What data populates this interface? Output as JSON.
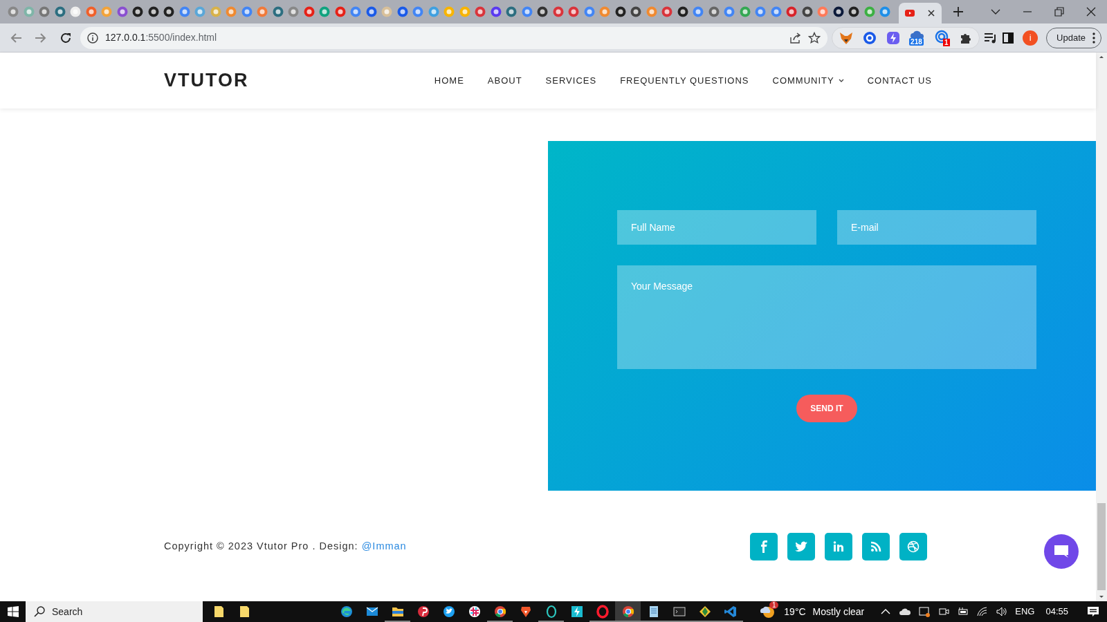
{
  "browser": {
    "tabs": [
      {
        "selected": false
      },
      {
        "selected": false
      },
      {
        "selected": false
      },
      {
        "selected": false
      },
      {
        "selected": false
      },
      {
        "selected": false
      },
      {
        "selected": false
      },
      {
        "selected": false
      },
      {
        "selected": false
      },
      {
        "selected": false
      },
      {
        "selected": false
      },
      {
        "selected": false
      },
      {
        "selected": false
      },
      {
        "selected": false
      },
      {
        "selected": false
      },
      {
        "selected": false
      },
      {
        "selected": false
      },
      {
        "selected": false
      },
      {
        "selected": false
      },
      {
        "selected": false
      },
      {
        "selected": false
      },
      {
        "selected": false
      },
      {
        "selected": false
      },
      {
        "selected": false
      },
      {
        "selected": false
      },
      {
        "selected": false
      },
      {
        "selected": false
      },
      {
        "selected": false
      },
      {
        "selected": false
      },
      {
        "selected": false
      },
      {
        "selected": false
      },
      {
        "selected": false
      },
      {
        "selected": false
      },
      {
        "selected": false
      },
      {
        "selected": false
      },
      {
        "selected": false
      },
      {
        "selected": false
      },
      {
        "selected": false
      },
      {
        "selected": false
      },
      {
        "selected": false
      },
      {
        "selected": false
      },
      {
        "selected": false
      },
      {
        "selected": false
      },
      {
        "selected": false
      },
      {
        "selected": false
      },
      {
        "selected": false
      },
      {
        "selected": false
      },
      {
        "selected": false
      },
      {
        "selected": false
      },
      {
        "selected": false
      },
      {
        "selected": false
      },
      {
        "selected": false
      },
      {
        "selected": false
      },
      {
        "selected": false
      },
      {
        "selected": false
      },
      {
        "selected": false
      },
      {
        "selected": false
      },
      {
        "selected": true
      }
    ],
    "address": {
      "host": "127.0.0.1",
      "rest": ":5500/index.html"
    },
    "extension_counter": "218",
    "extension_alert": "1",
    "profile_initial": "i",
    "update_button": "Update"
  },
  "site": {
    "logo": "VTUTOR",
    "nav": [
      {
        "label": "HOME",
        "dropdown": false
      },
      {
        "label": "ABOUT",
        "dropdown": false
      },
      {
        "label": "SERVICES",
        "dropdown": false
      },
      {
        "label": "FREQUENTLY QUESTIONS",
        "dropdown": false
      },
      {
        "label": "COMMUNITY",
        "dropdown": true
      },
      {
        "label": "CONTACT US",
        "dropdown": false
      }
    ],
    "form": {
      "name_placeholder": "Full Name",
      "email_placeholder": "E-mail",
      "message_placeholder": "Your Message",
      "submit": "SEND IT"
    },
    "footer": {
      "copyright": "Copyright © 2023 Vtutor Pro . Design: ",
      "credit_link": "@Imman"
    },
    "socials": [
      {
        "kind": "facebook"
      },
      {
        "kind": "twitter"
      },
      {
        "kind": "linkedin"
      },
      {
        "kind": "rss"
      },
      {
        "kind": "dribbble"
      }
    ]
  },
  "taskbar": {
    "search_placeholder": "Search",
    "apps": [
      {
        "kind": "note",
        "running": false,
        "active": false
      },
      {
        "kind": "note",
        "running": false,
        "active": false
      },
      {
        "kind": "edge",
        "running": false,
        "active": false
      },
      {
        "kind": "mail",
        "running": false,
        "active": false
      },
      {
        "kind": "folder",
        "running": true,
        "active": false
      },
      {
        "kind": "pinterest",
        "running": false,
        "active": false
      },
      {
        "kind": "twitter",
        "running": false,
        "active": false
      },
      {
        "kind": "slack",
        "running": false,
        "active": false
      },
      {
        "kind": "chrome",
        "running": true,
        "active": false
      },
      {
        "kind": "brave",
        "running": false,
        "active": false
      },
      {
        "kind": "ring",
        "running": true,
        "active": false
      },
      {
        "kind": "bolt",
        "running": false,
        "active": false
      },
      {
        "kind": "opera",
        "running": true,
        "active": false
      },
      {
        "kind": "chrome",
        "running": true,
        "active": true
      },
      {
        "kind": "notepad",
        "running": true,
        "active": false
      },
      {
        "kind": "terminal",
        "running": true,
        "active": false
      },
      {
        "kind": "git",
        "running": true,
        "active": false
      },
      {
        "kind": "vscode",
        "running": true,
        "active": false
      }
    ],
    "weather": {
      "badge": "1",
      "temperature": "19°C",
      "condition": "Mostly clear"
    },
    "language": "ENG",
    "time": "04:55"
  }
}
